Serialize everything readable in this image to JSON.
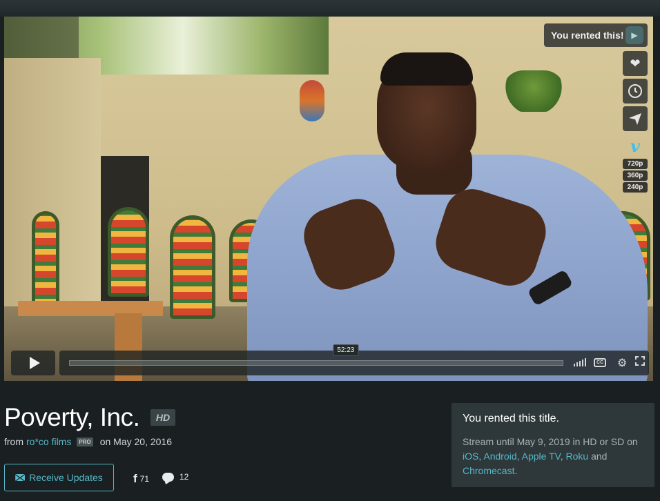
{
  "video": {
    "rent_badge": "You rented this!",
    "timestamp_tooltip": "52:23",
    "resolutions": [
      "720p",
      "360p",
      "240p"
    ],
    "progress_fraction": 0.0,
    "hover_fraction": 0.56,
    "icons": {
      "like": "heart-icon",
      "watch_later": "clock-icon",
      "share": "paper-plane-icon",
      "vimeo": "vimeo-logo-icon",
      "play": "play-icon",
      "volume": "volume-icon",
      "captions": "cc-icon",
      "settings": "gear-icon",
      "fullscreen": "fullscreen-icon"
    }
  },
  "info": {
    "title": "Poverty, Inc.",
    "hd_badge": "HD",
    "from_prefix": "from",
    "author": "ro*co films",
    "pro_badge": "PRO",
    "date_text": "on May 20, 2016",
    "receive_updates": "Receive Updates",
    "facebook_count": "71",
    "comment_count": "12"
  },
  "rental": {
    "heading": "You rented this title.",
    "line_prefix": "Stream until May 9, 2019 in HD or SD on ",
    "platforms": [
      "iOS",
      "Android",
      "Apple TV",
      "Roku"
    ],
    "and_word": "and",
    "last_platform": "Chromecast",
    "period": "."
  },
  "colors": {
    "accent": "#56b8c8",
    "background": "#1a2022",
    "card": "#2e3739"
  }
}
